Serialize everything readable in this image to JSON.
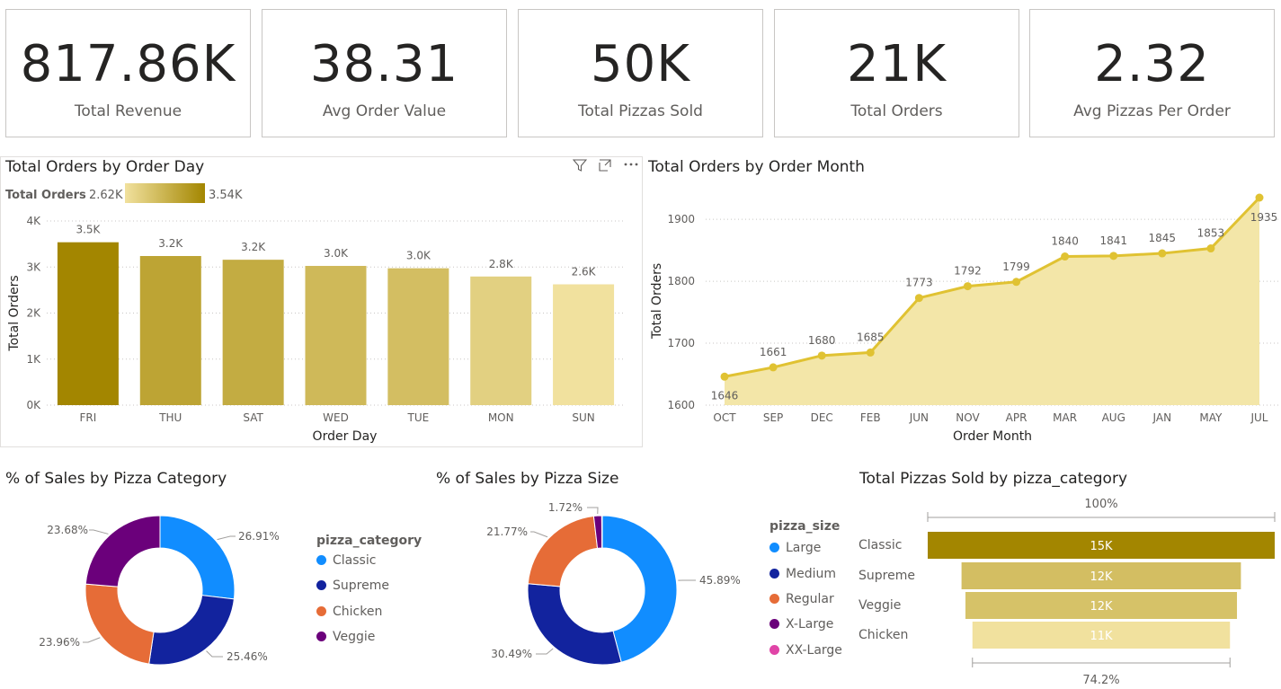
{
  "kpis": [
    {
      "value": "817.86K",
      "label": "Total Revenue"
    },
    {
      "value": "38.31",
      "label": "Avg Order Value"
    },
    {
      "value": "50K",
      "label": "Total Pizzas Sold"
    },
    {
      "value": "21K",
      "label": "Total Orders"
    },
    {
      "value": "2.32",
      "label": "Avg Pizzas Per Order"
    }
  ],
  "colors": {
    "gold_dark": "#a38600",
    "gold_light": "#f1e19e",
    "line": "#e0c232",
    "area": "#f3e6a8",
    "classic": "#118dff",
    "supreme": "#12239e",
    "chicken": "#e66c37",
    "veggie": "#6b007b",
    "xxlarge": "#e044a7"
  },
  "icons": [
    "filter-icon",
    "focus-mode-icon",
    "more-options-icon"
  ],
  "chart_data": [
    {
      "type": "bar",
      "title": "Total Orders by Order Day",
      "xlabel": "Order Day",
      "ylabel": "Total Orders",
      "categories": [
        "FRI",
        "THU",
        "SAT",
        "WED",
        "TUE",
        "MON",
        "SUN"
      ],
      "values": [
        3538,
        3239,
        3158,
        3024,
        2973,
        2794,
        2624
      ],
      "data_labels": [
        "3.5K",
        "3.2K",
        "3.2K",
        "3.0K",
        "3.0K",
        "2.8K",
        "2.6K"
      ],
      "ylim": [
        0,
        4000
      ],
      "yticks": [
        "0K",
        "1K",
        "2K",
        "3K",
        "4K"
      ],
      "grid": true,
      "color_legend": {
        "title": "Total Orders",
        "min": "2.62K",
        "max": "3.54K"
      }
    },
    {
      "type": "area",
      "title": "Total Orders by Order Month",
      "xlabel": "Order Month",
      "ylabel": "Total Orders",
      "categories": [
        "OCT",
        "SEP",
        "DEC",
        "FEB",
        "JUN",
        "NOV",
        "APR",
        "MAR",
        "AUG",
        "JAN",
        "MAY",
        "JUL"
      ],
      "values": [
        1646,
        1661,
        1680,
        1685,
        1773,
        1792,
        1799,
        1840,
        1841,
        1845,
        1853,
        1935
      ],
      "ylim": [
        1600,
        1935
      ],
      "yticks": [
        "1600",
        "1700",
        "1800",
        "1900"
      ],
      "grid": true
    },
    {
      "type": "pie",
      "title": "% of Sales by Pizza Category",
      "legend_title": "pizza_category",
      "legend_placement": "right",
      "slices": [
        {
          "name": "Classic",
          "value": 26.91,
          "label": "26.91%"
        },
        {
          "name": "Supreme",
          "value": 25.46,
          "label": "25.46%"
        },
        {
          "name": "Chicken",
          "value": 23.96,
          "label": "23.96%"
        },
        {
          "name": "Veggie",
          "value": 23.68,
          "label": "23.68%"
        }
      ]
    },
    {
      "type": "pie",
      "title": "% of Sales by Pizza Size",
      "legend_title": "pizza_size",
      "legend_placement": "right",
      "legend_items": [
        "Large",
        "Medium",
        "Regular",
        "X-Large",
        "XX-Large"
      ],
      "slices": [
        {
          "name": "Large",
          "value": 45.89,
          "label": "45.89%"
        },
        {
          "name": "Medium",
          "value": 30.49,
          "label": "30.49%"
        },
        {
          "name": "Regular",
          "value": 21.77,
          "label": "21.77%"
        },
        {
          "name": "X-Large",
          "value": 1.72,
          "label": "1.72%"
        },
        {
          "name": "XX-Large",
          "value": 0.12,
          "label": ""
        }
      ]
    },
    {
      "type": "bar",
      "title": "Total Pizzas Sold by pizza_category",
      "categories": [
        "Classic",
        "Supreme",
        "Veggie",
        "Chicken"
      ],
      "values": [
        14888,
        11987,
        11649,
        11050
      ],
      "data_labels": [
        "15K",
        "12K",
        "12K",
        "11K"
      ],
      "top_label": "100%",
      "bottom_label": "74.2%"
    }
  ]
}
